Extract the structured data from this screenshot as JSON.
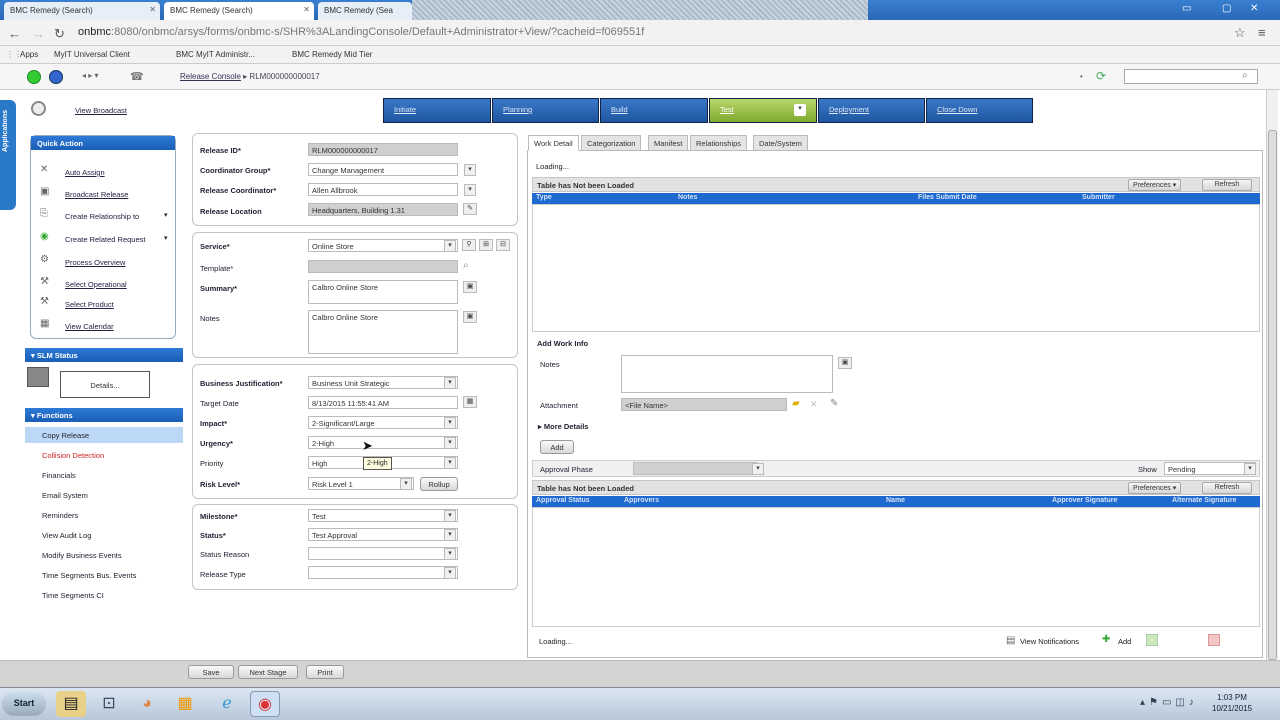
{
  "browser": {
    "tabs": [
      {
        "title": "BMC Remedy (Search)"
      },
      {
        "title": "BMC Remedy (Search)"
      },
      {
        "title": "BMC Remedy (Sea"
      }
    ],
    "url_host": "onbmc",
    "url_rest": ":8080/onbmc/arsys/forms/onbmc-s/SHR%3ALandingConsole/Default+Administrator+View/?cacheid=f069551f",
    "bookmarks": [
      "Apps",
      "MyIT Universal Client",
      "BMC MyIT Administr...",
      "BMC Remedy Mid Tier"
    ]
  },
  "apptop": {
    "breadcrumb_link": "Release Console",
    "breadcrumb_current": "RLM000000000017",
    "apps_tab": "Applications"
  },
  "header_link": "View Broadcast",
  "process_stages": [
    "Initiate",
    "Planning",
    "Build",
    "Test",
    "Deployment",
    "Close Down"
  ],
  "quick_actions": {
    "title": "Quick Action",
    "items": [
      {
        "label": "Auto Assign",
        "icon": "auto-assign-icon"
      },
      {
        "label": "Broadcast Release",
        "icon": "broadcast-icon"
      },
      {
        "label": "Create Relationship to",
        "icon": "relationship-icon"
      },
      {
        "label": "Create Related Request",
        "icon": "related-request-icon"
      },
      {
        "label": "Process Overview",
        "icon": "process-icon"
      },
      {
        "label": "Select Operational",
        "icon": "operational-icon"
      },
      {
        "label": "Select Product",
        "icon": "product-icon"
      },
      {
        "label": "View Calendar",
        "icon": "calendar-icon"
      }
    ]
  },
  "slm": {
    "title": "SLM Status",
    "details_label": "Details..."
  },
  "functions": {
    "title": "Functions",
    "items": [
      "Copy Release",
      "Collision Detection",
      "Financials",
      "Email System",
      "Reminders",
      "View Audit Log",
      "Modify Business Events",
      "Time Segments Bus. Events",
      "Time Segments CI"
    ]
  },
  "form": {
    "release_id_label": "Release ID*",
    "release_id": "RLM000000000017",
    "coordinator_group_label": "Coordinator Group*",
    "coordinator_group": "Change Management",
    "release_coordinator_label": "Release Coordinator*",
    "release_coordinator": "Allen Allbrook",
    "release_location_label": "Release Location",
    "release_location": "Headquarters, Building 1.31",
    "service_label": "Service*",
    "service": "Online Store",
    "template_label": "Template*",
    "summary_label": "Summary*",
    "summary": "Calbro Online Store",
    "notes_label": "Notes",
    "notes": "Calbro Online Store",
    "business_justification_label": "Business Justification*",
    "business_justification": "Business Unit Strategic",
    "target_date_label": "Target Date",
    "target_date": "8/13/2015 11:55:41 AM",
    "impact_label": "Impact*",
    "impact": "2-Significant/Large",
    "urgency_label": "Urgency*",
    "urgency": "2-High",
    "priority_label": "Priority",
    "priority": "High",
    "priority_tooltip": "2-High",
    "risk_level_label": "Risk Level*",
    "risk_level": "Risk Level 1",
    "rollup_label": "Rollup",
    "milestone_label": "Milestone*",
    "milestone": "Test",
    "status_label": "Status*",
    "status": "Test Approval",
    "status_reason_label": "Status Reason",
    "status_reason": "",
    "release_type_label": "Release Type",
    "release_type": ""
  },
  "right": {
    "tabs": [
      "Work Detail",
      "Categorization",
      "Manifest",
      "Relationships",
      "Date/System"
    ],
    "loading_label": "Loading...",
    "work_table": {
      "title": "Table has Not been Loaded",
      "preferences": "Preferences",
      "refresh": "Refresh",
      "columns": [
        "Type",
        "Notes",
        "Files Submit Date",
        "Submitter"
      ]
    },
    "add_work_info": "Add Work Info",
    "notes_label": "Notes",
    "attachment_label": "Attachment",
    "attachment_placeholder": "<File Name>",
    "more_details": "More Details",
    "add_label": "Add",
    "approval_phase_label": "Approval Phase",
    "show_label": "Show",
    "show_value": "Pending",
    "approval_table": {
      "title": "Table has Not been Loaded",
      "preferences": "Preferences",
      "refresh": "Refresh",
      "columns": [
        "Approval Status",
        "Approvers",
        "Name",
        "Approver Signature",
        "Alternate Signature"
      ]
    },
    "footer_loading": "Loading...",
    "view_notifications": "View Notifications",
    "footer_add": "Add"
  },
  "bottom_buttons": [
    "Save",
    "Next Stage",
    "Print"
  ],
  "taskbar": {
    "start": "Start",
    "clock_time": "1:03 PM",
    "clock_date": "10/21/2015"
  }
}
